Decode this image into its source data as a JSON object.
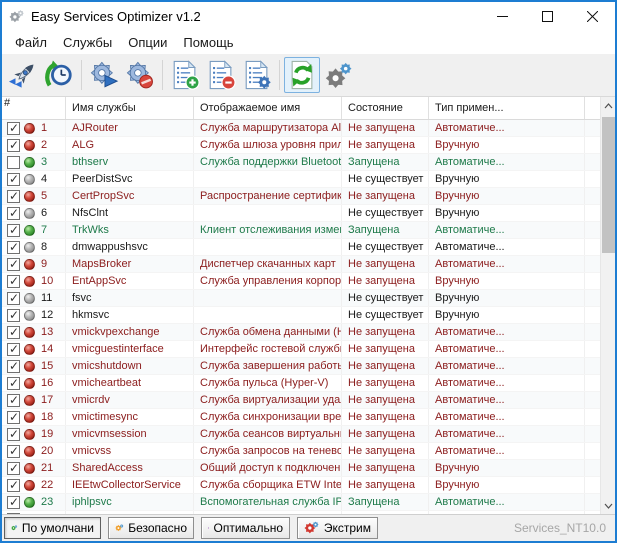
{
  "window": {
    "title": "Easy Services Optimizer v1.2"
  },
  "menu": {
    "items": [
      "Файл",
      "Службы",
      "Опции",
      "Помощь"
    ]
  },
  "toolbar": {
    "buttons": [
      {
        "name": "apply-services",
        "icon": "rocket-icon"
      },
      {
        "name": "restore-backup",
        "icon": "history-clock-icon"
      },
      {
        "name": "start-service",
        "icon": "gear-play-icon"
      },
      {
        "name": "stop-service",
        "icon": "gear-stop-icon"
      },
      {
        "name": "add-service",
        "icon": "list-add-icon"
      },
      {
        "name": "remove-service",
        "icon": "list-remove-icon"
      },
      {
        "name": "edit-service",
        "icon": "list-gear-icon"
      },
      {
        "name": "refresh-list",
        "icon": "refresh-icon",
        "selected": true
      },
      {
        "name": "settings",
        "icon": "gears-icon"
      }
    ]
  },
  "table": {
    "columns": [
      "#",
      "Имя службы",
      "Отображаемое имя",
      "Состояние",
      "Тип примен..."
    ],
    "status_text_colors": {
      "red": "#8B1C1C",
      "green": "#1E7A4A",
      "gray": "#1A1A1A"
    },
    "rows": [
      {
        "num": "1",
        "checked": true,
        "status": "red",
        "name": "AJRouter",
        "display": "Служба маршрутизатора AllJ...",
        "state": "Не запущена",
        "type": "Автоматиче..."
      },
      {
        "num": "2",
        "checked": true,
        "status": "red",
        "name": "ALG",
        "display": "Служба шлюза уровня прило...",
        "state": "Не запущена",
        "type": "Вручную"
      },
      {
        "num": "3",
        "checked": false,
        "status": "green",
        "name": "bthserv",
        "display": "Служба поддержки Bluetooth",
        "state": "Запущена",
        "type": "Автоматиче..."
      },
      {
        "num": "4",
        "checked": true,
        "status": "gray",
        "name": "PeerDistSvc",
        "display": "",
        "state": "Не существует",
        "type": "Вручную"
      },
      {
        "num": "5",
        "checked": true,
        "status": "red",
        "name": "CertPropSvc",
        "display": "Распространение сертификата",
        "state": "Не запущена",
        "type": "Вручную"
      },
      {
        "num": "6",
        "checked": true,
        "status": "gray",
        "name": "NfsClnt",
        "display": "",
        "state": "Не существует",
        "type": "Вручную"
      },
      {
        "num": "7",
        "checked": true,
        "status": "green",
        "name": "TrkWks",
        "display": "Клиент отслеживания измени...",
        "state": "Запущена",
        "type": "Автоматиче..."
      },
      {
        "num": "8",
        "checked": true,
        "status": "gray",
        "name": "dmwappushsvc",
        "display": "",
        "state": "Не существует",
        "type": "Автоматиче..."
      },
      {
        "num": "9",
        "checked": true,
        "status": "red",
        "name": "MapsBroker",
        "display": "Диспетчер скачанных карт",
        "state": "Не запущена",
        "type": "Автоматиче..."
      },
      {
        "num": "10",
        "checked": true,
        "status": "red",
        "name": "EntAppSvc",
        "display": "Служба управления корпора...",
        "state": "Не запущена",
        "type": "Вручную"
      },
      {
        "num": "11",
        "checked": true,
        "status": "gray",
        "name": "fsvc",
        "display": "",
        "state": "Не существует",
        "type": "Вручную"
      },
      {
        "num": "12",
        "checked": true,
        "status": "gray",
        "name": "hkmsvc",
        "display": "",
        "state": "Не существует",
        "type": "Вручную"
      },
      {
        "num": "13",
        "checked": true,
        "status": "red",
        "name": "vmickvpexchange",
        "display": "Служба обмена данными (Hy...",
        "state": "Не запущена",
        "type": "Автоматиче..."
      },
      {
        "num": "14",
        "checked": true,
        "status": "red",
        "name": "vmicguestinterface",
        "display": "Интерфейс гостевой службы ...",
        "state": "Не запущена",
        "type": "Автоматиче..."
      },
      {
        "num": "15",
        "checked": true,
        "status": "red",
        "name": "vmicshutdown",
        "display": "Служба завершения работы ...",
        "state": "Не запущена",
        "type": "Автоматиче..."
      },
      {
        "num": "16",
        "checked": true,
        "status": "red",
        "name": "vmicheartbeat",
        "display": "Служба пульса (Hyper-V)",
        "state": "Не запущена",
        "type": "Автоматиче..."
      },
      {
        "num": "17",
        "checked": true,
        "status": "red",
        "name": "vmicrdv",
        "display": "Служба виртуализации удал...",
        "state": "Не запущена",
        "type": "Автоматиче..."
      },
      {
        "num": "18",
        "checked": true,
        "status": "red",
        "name": "vmictimesync",
        "display": "Служба синхронизации време...",
        "state": "Не запущена",
        "type": "Автоматиче..."
      },
      {
        "num": "19",
        "checked": true,
        "status": "red",
        "name": "vmicvmsession",
        "display": "Служба сеансов виртуальны...",
        "state": "Не запущена",
        "type": "Автоматиче..."
      },
      {
        "num": "20",
        "checked": true,
        "status": "red",
        "name": "vmicvss",
        "display": "Служба запросов на теневое ...",
        "state": "Не запущена",
        "type": "Автоматиче..."
      },
      {
        "num": "21",
        "checked": true,
        "status": "red",
        "name": "SharedAccess",
        "display": "Общий доступ к подключени...",
        "state": "Не запущена",
        "type": "Вручную"
      },
      {
        "num": "22",
        "checked": true,
        "status": "red",
        "name": "IEEtwCollectorService",
        "display": "Служба сборщика ETW Intern...",
        "state": "Не запущена",
        "type": "Вручную"
      },
      {
        "num": "23",
        "checked": true,
        "status": "green",
        "name": "iphlpsvc",
        "display": "Вспомогательная служба IP",
        "state": "Запущена",
        "type": "Автоматиче..."
      },
      {
        "num": "",
        "checked": true,
        "status": "red",
        "name": "",
        "display": "",
        "state": "",
        "type": "",
        "partial": true
      }
    ]
  },
  "statusbar": {
    "buttons": [
      {
        "label": "По умолчани",
        "color": "#3AA33A",
        "pressed": true
      },
      {
        "label": "Безопасно",
        "color": "#F0A02F"
      },
      {
        "label": "Оптимально",
        "color": "#9A41B4"
      },
      {
        "label": "Экстрим",
        "color": "#D23830"
      }
    ],
    "right_text": "Services_NT10.0"
  }
}
